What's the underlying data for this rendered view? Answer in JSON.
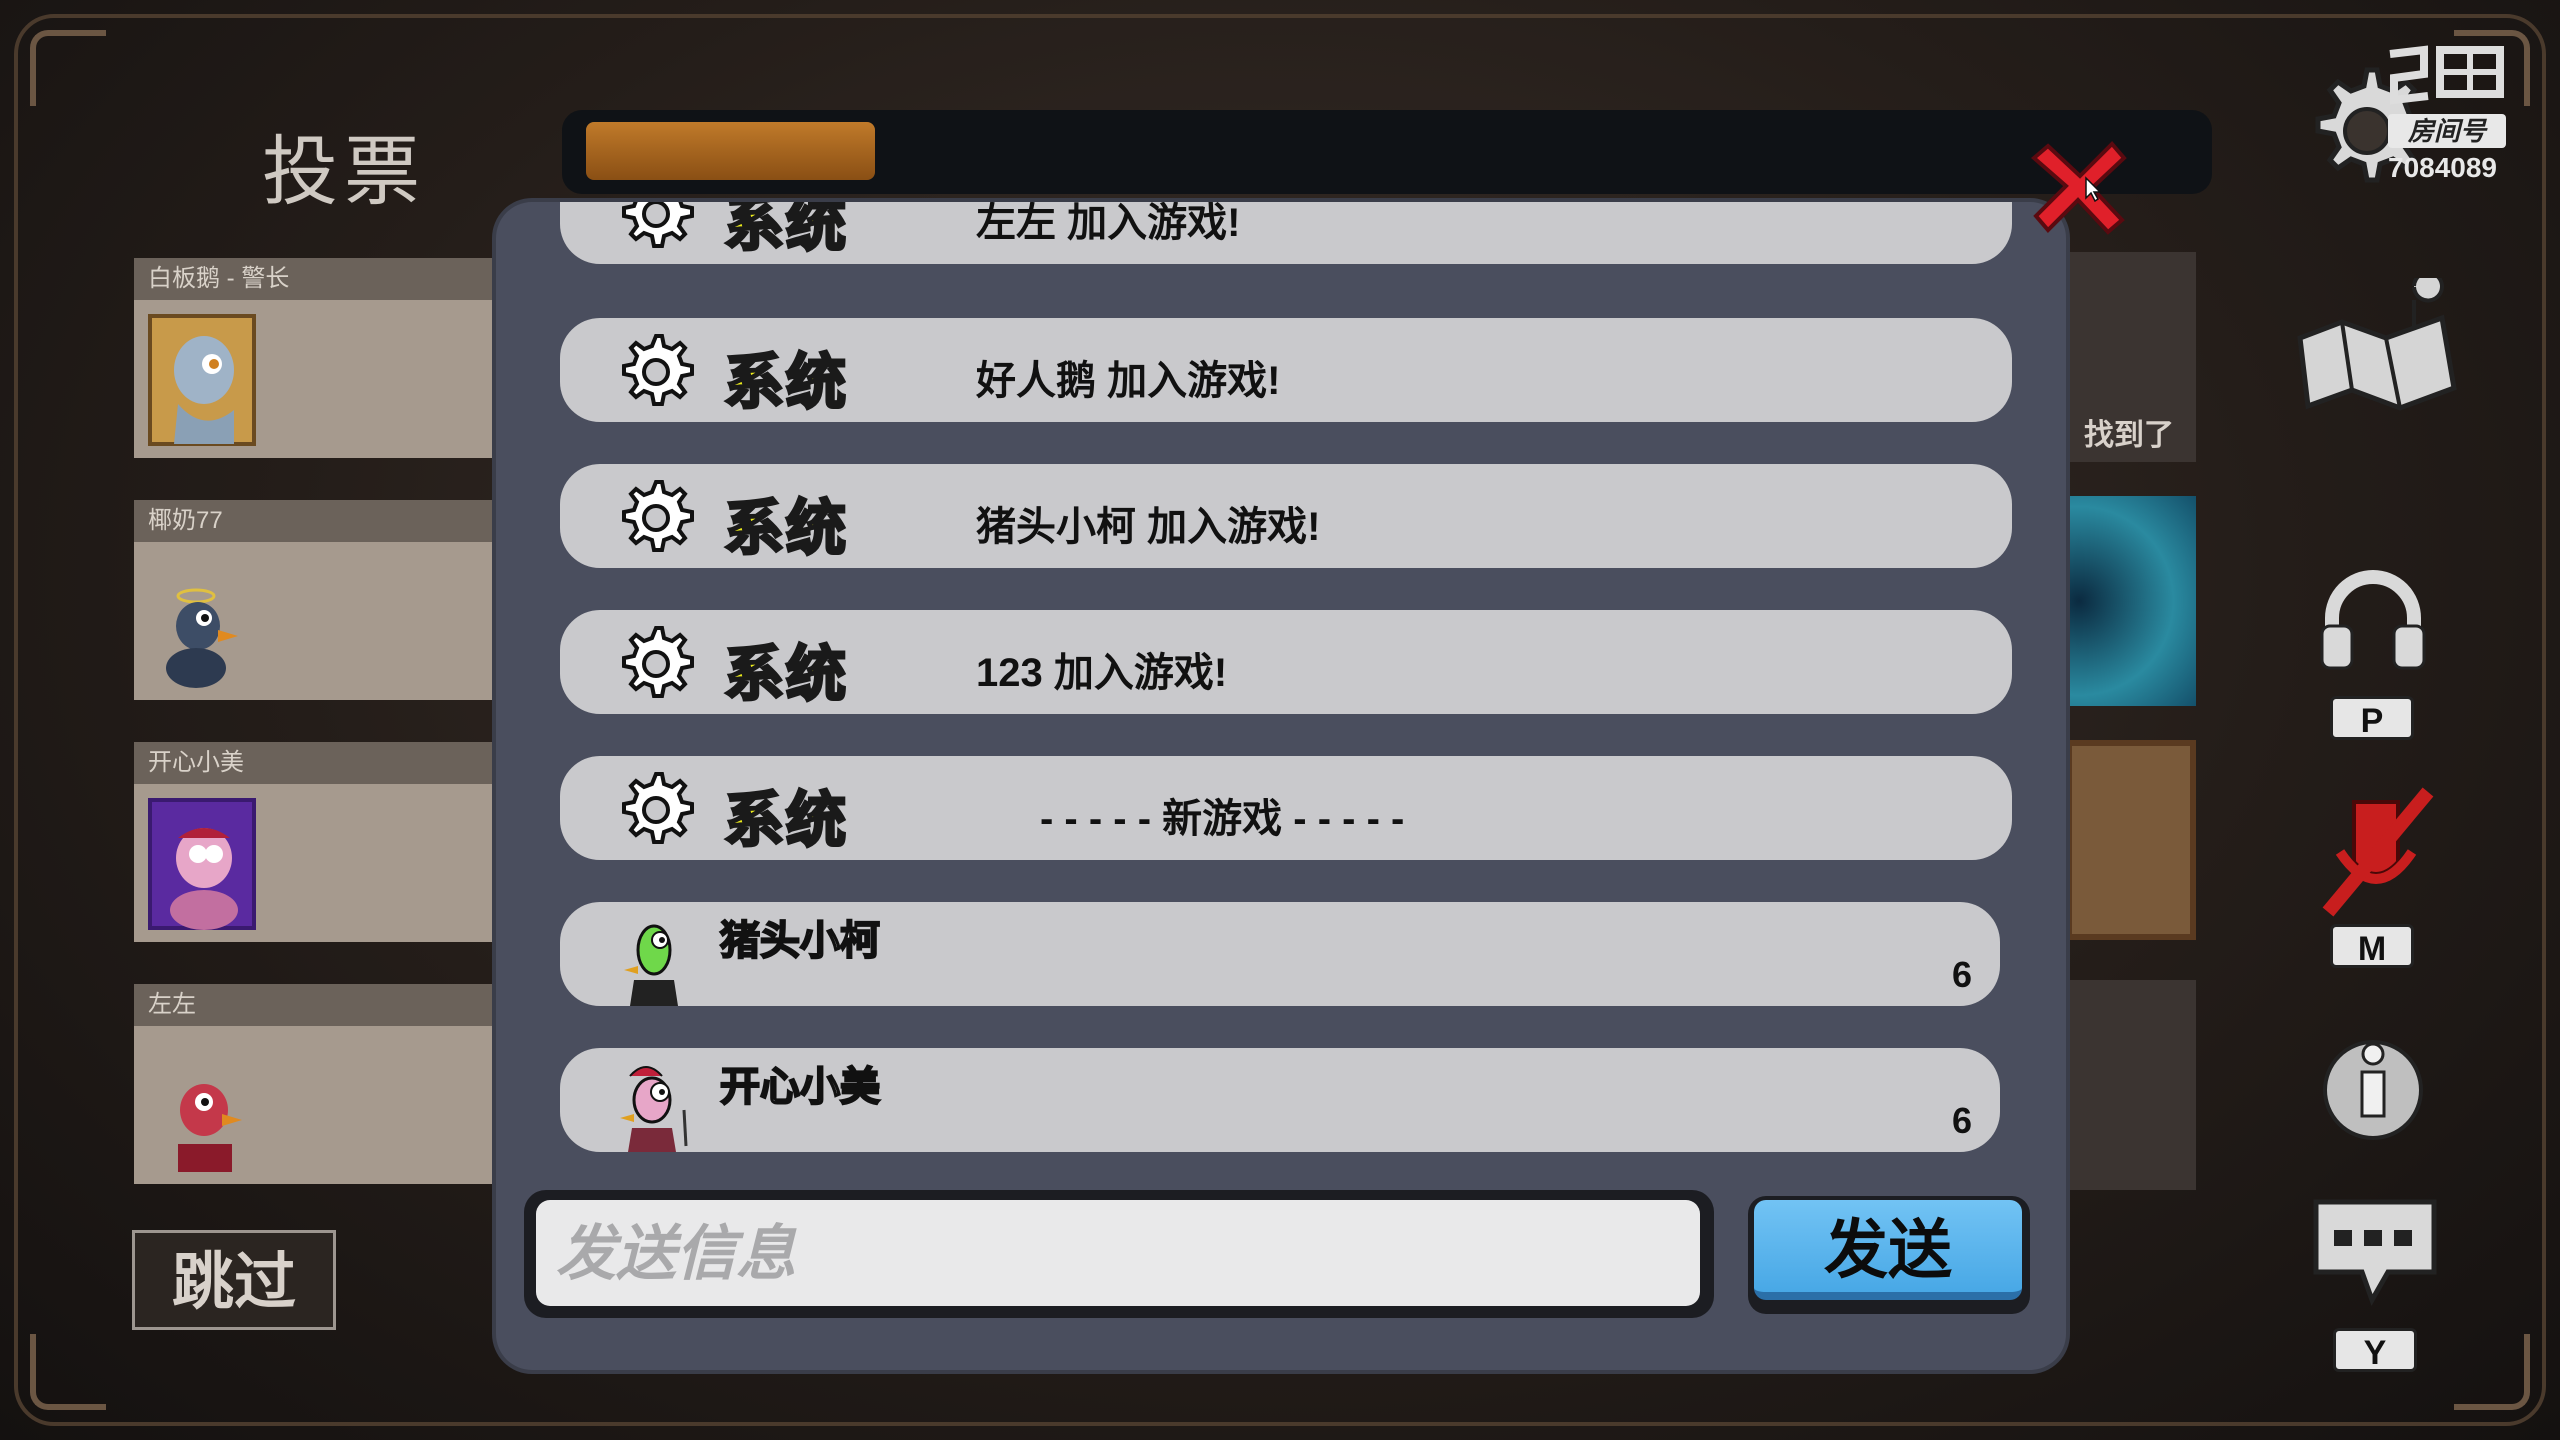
{
  "title": "投票",
  "timer": {
    "progress": 0.18
  },
  "players": [
    {
      "name": "白板鹅 - 警长"
    },
    {
      "name": "椰奶77"
    },
    {
      "name": "开心小美"
    },
    {
      "name": "左左"
    }
  ],
  "skip_label": "跳过",
  "right_card_text": "找到了",
  "room": {
    "label": "房间号",
    "number": "7084089"
  },
  "hotkeys": {
    "voice": "P",
    "mute": "M",
    "chat": "Y"
  },
  "chat": {
    "messages": [
      {
        "sender": "系统",
        "text": "左左 加入游戏!"
      },
      {
        "sender": "系统",
        "text": "好人鹅 加入游戏!"
      },
      {
        "sender": "系统",
        "text": "猪头小柯 加入游戏!"
      },
      {
        "sender": "系统",
        "text": "123 加入游戏!"
      },
      {
        "sender": "系统",
        "text": "- - - - - 新游戏 - - - - -"
      },
      {
        "sender": "猪头小柯",
        "count": "6"
      },
      {
        "sender": "开心小美",
        "count": "6"
      }
    ],
    "input_placeholder": "发送信息",
    "send_label": "发送"
  },
  "colors": {
    "system_text": "#ecec1c",
    "send_button": "#58b2ec",
    "close_button": "#e0202a",
    "timer_fill": "#b06d22"
  }
}
